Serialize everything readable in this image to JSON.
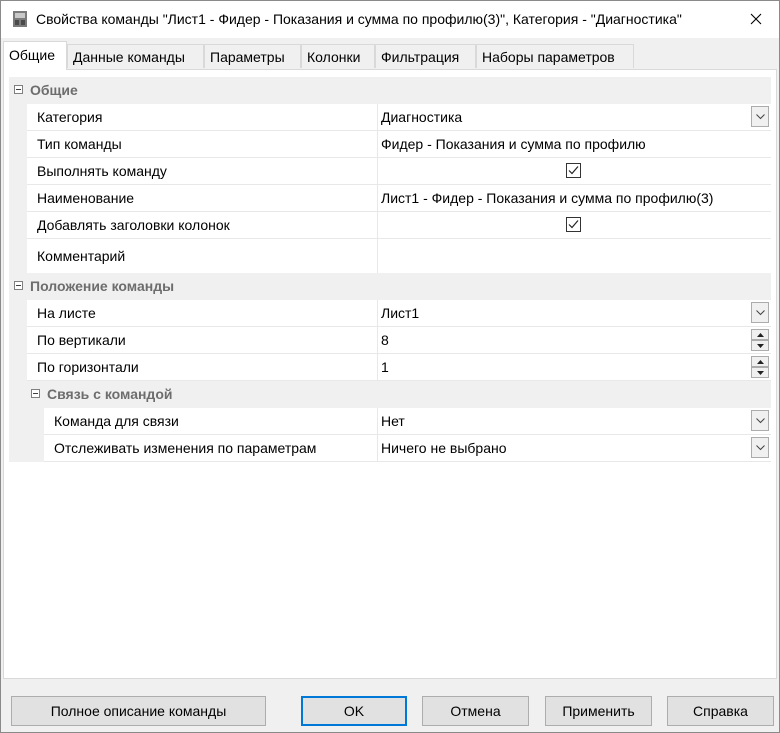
{
  "window": {
    "title": "Свойства команды \"Лист1 - Фидер - Показания и сумма по профилю(3)\", Категория - \"Диагностика\"",
    "close_glyph": "✕"
  },
  "tabs": [
    {
      "label": "Общие",
      "active": true
    },
    {
      "label": "Данные команды"
    },
    {
      "label": "Параметры"
    },
    {
      "label": "Колонки"
    },
    {
      "label": "Фильтрация"
    },
    {
      "label": "Наборы параметров"
    }
  ],
  "categories": {
    "general": "Общие",
    "position": "Положение команды",
    "link": "Связь с командой"
  },
  "props": {
    "category": {
      "name": "Категория",
      "value": "Диагностика"
    },
    "type": {
      "name": "Тип команды",
      "value": "Фидер - Показания и сумма по профилю"
    },
    "execute": {
      "name": "Выполнять команду",
      "checked": true
    },
    "title": {
      "name": "Наименование",
      "value": "Лист1 - Фидер - Показания и сумма по профилю(3)"
    },
    "headers": {
      "name": "Добавлять заголовки колонок",
      "checked": true
    },
    "comment": {
      "name": "Комментарий",
      "value": ""
    },
    "sheet": {
      "name": "На листе",
      "value": "Лист1"
    },
    "vertical": {
      "name": "По вертикали",
      "value": "8"
    },
    "horizontal": {
      "name": "По горизонтали",
      "value": "1"
    },
    "link_cmd": {
      "name": "Команда для связи",
      "value": "Нет"
    },
    "track": {
      "name": "Отслеживать изменения по параметрам",
      "value": "Ничего не выбрано"
    }
  },
  "buttons": {
    "full_desc": "Полное описание команды",
    "ok": "OK",
    "cancel": "Отмена",
    "apply": "Применить",
    "help": "Справка"
  },
  "colors": {
    "accent": "#0078d7",
    "category_text": "#6d6d6d"
  }
}
